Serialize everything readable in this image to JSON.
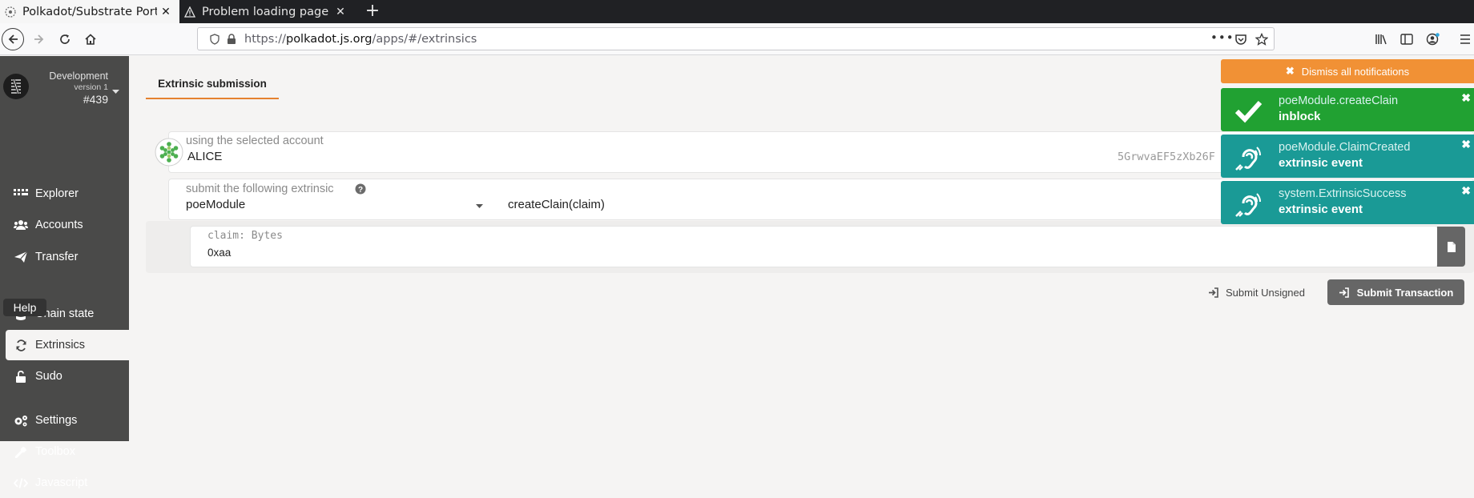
{
  "browser": {
    "tabs": [
      {
        "title": "Polkadot/Substrate Portal",
        "active": true
      },
      {
        "title": "Problem loading page",
        "active": false
      }
    ],
    "url_prefix": "https://",
    "url_host": "polkadot.js.org",
    "url_path": "/apps/#/extrinsics"
  },
  "sidebar": {
    "chain_name": "Development",
    "chain_version": "version 1",
    "block_number": "#439",
    "items": [
      {
        "label": "Explorer",
        "icon": "explorer-icon"
      },
      {
        "label": "Accounts",
        "icon": "accounts-icon"
      },
      {
        "label": "Transfer",
        "icon": "transfer-icon"
      },
      {
        "label": "Chain state",
        "icon": "database-icon"
      },
      {
        "label": "Extrinsics",
        "icon": "sync-icon"
      },
      {
        "label": "Sudo",
        "icon": "unlock-icon"
      },
      {
        "label": "Settings",
        "icon": "cogs-icon"
      },
      {
        "label": "Toolbox",
        "icon": "wrench-icon"
      },
      {
        "label": "Javascript",
        "icon": "code-icon"
      }
    ],
    "tooltip": "Help"
  },
  "main": {
    "tab_label": "Extrinsic submission",
    "account": {
      "label": "using the selected account",
      "name": "ALICE",
      "address": "5GrwvaEF5zXb26F"
    },
    "extrinsic": {
      "label": "submit the following extrinsic",
      "module": "poeModule",
      "method": "createClain(claim)"
    },
    "param": {
      "label": "claim: Bytes",
      "value": "0xaa"
    },
    "submit_unsigned_label": "Submit Unsigned",
    "submit_transaction_label": "Submit Transaction"
  },
  "notifications": {
    "dismiss_label": "Dismiss all notifications",
    "items": [
      {
        "title": "poeModule.createClain",
        "status": "inblock",
        "color": "#21a132",
        "icon": "check-icon"
      },
      {
        "title": "poeModule.ClaimCreated",
        "status": "extrinsic event",
        "color": "#1a9a96",
        "icon": "assistive-listening-icon"
      },
      {
        "title": "system.ExtrinsicSuccess",
        "status": "extrinsic event",
        "color": "#1a9a96",
        "icon": "assistive-listening-icon"
      }
    ]
  },
  "colors": {
    "accent": "#e5822f",
    "sidebar_bg": "#4a4a49",
    "success": "#21a132",
    "event": "#1a9a96",
    "warning": "#f19135"
  }
}
